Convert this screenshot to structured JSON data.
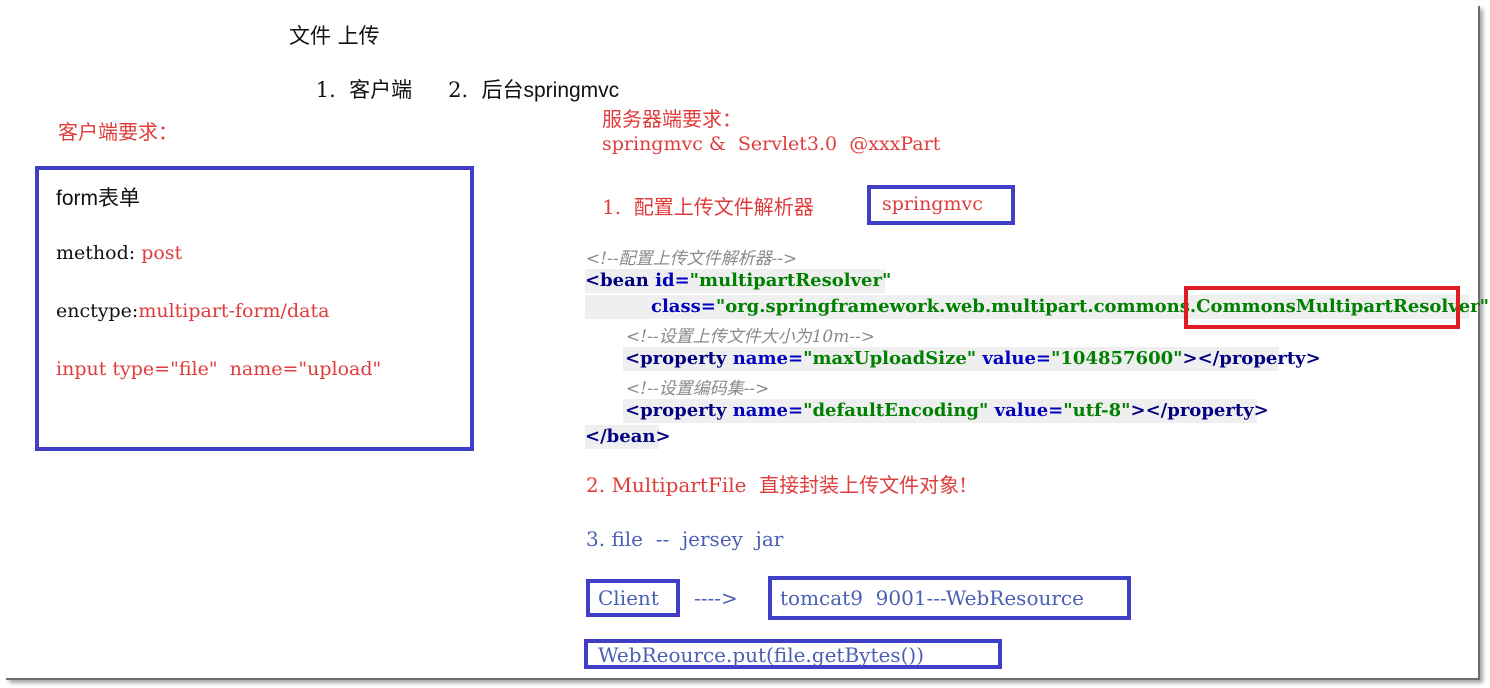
{
  "header": {
    "title": "文件 上传",
    "subtitle_item1": "1.  客户端",
    "subtitle_item2": "2.  后台",
    "subtitle_item2_suffix": "springmvc"
  },
  "client": {
    "heading": "客户端要求：",
    "form_title_prefix": "form",
    "form_title_suffix": "表单",
    "method_label": "method: ",
    "method_value": "post",
    "enctype_label": "enctype:",
    "enctype_value": "multipart-form/data",
    "input_line": "input type=\"file\"  name=\"upload\""
  },
  "server": {
    "heading": "服务器端要求：",
    "requirement_line": "springmvc &  Servlet3.0  @xxxPart",
    "step1_label": "1.  配置上传文件解析器",
    "step1_box": "springmvc",
    "code": {
      "comment1": "<!--配置上传文件解析器-->",
      "bean_open_tag": "<bean",
      "bean_id_attr": " id=",
      "bean_id_value": "\"multipartResolver\"",
      "class_attr": "class=",
      "class_value_prefix": "\"org.springframework.web.multipart.commons.",
      "class_value_highlight": "CommonsMultipartResolver",
      "class_value_end": "\"",
      "class_close": ">",
      "comment2": "<!--设置上传文件大小为10m-->",
      "prop1_open": "<property",
      "prop1_name_attr": " name=",
      "prop1_name_value": "\"maxUploadSize\"",
      "prop1_value_attr": " value=",
      "prop1_value_value": "\"104857600\"",
      "prop1_close": "></property>",
      "comment3": "<!--设置编码集-->",
      "prop2_open": "<property",
      "prop2_name_attr": " name=",
      "prop2_name_value": "\"defaultEncoding\"",
      "prop2_value_attr": " value=",
      "prop2_value_value": "\"utf-8\"",
      "prop2_close": "></property>",
      "bean_close": "</bean>"
    },
    "step2": "2. MultipartFile  直接封装上传文件对象!",
    "step3": "3. file  --  jersey  jar",
    "client_box": "Client",
    "arrow": "---->",
    "tomcat_box": "tomcat9  9001---WebResource",
    "webresource_box": "WebReource.put(file.getBytes())"
  },
  "colors": {
    "red_text": "#e03c3c",
    "blue_text": "#4a5fb4",
    "blue_box": "#3f3fc7",
    "red_box": "#e01b24"
  }
}
